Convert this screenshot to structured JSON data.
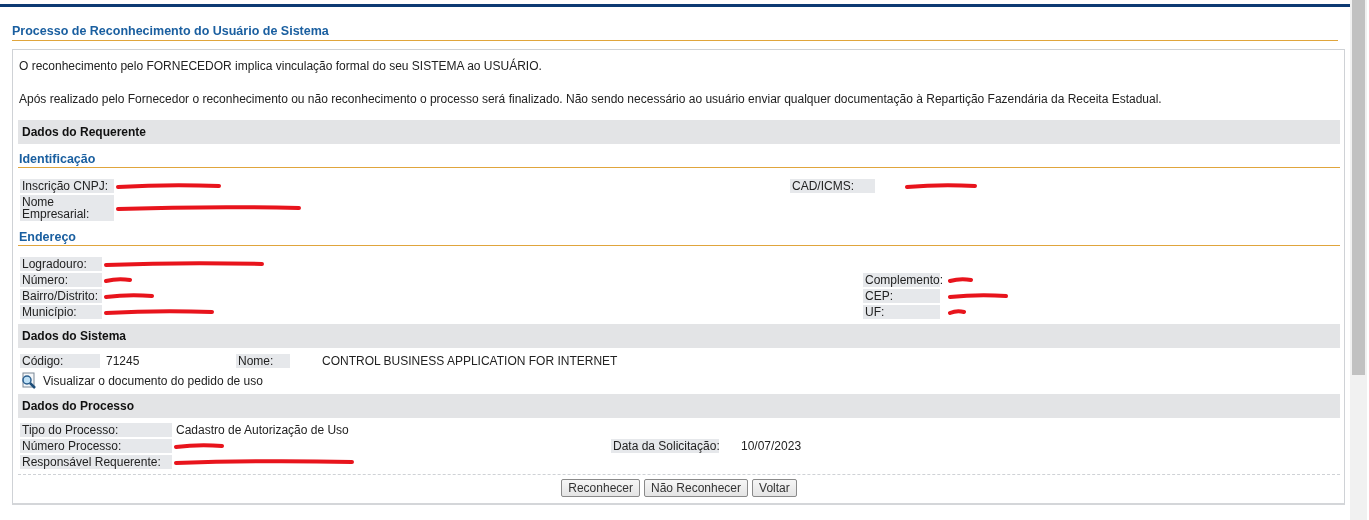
{
  "title": "Processo de Reconhecimento do Usuário de Sistema",
  "intro": [
    "O reconhecimento pelo FORNECEDOR implica vinculação formal do seu SISTEMA ao USUÁRIO.",
    "Após realizado pelo Fornecedor o reconhecimento ou não reconhecimento o processo será finalizado. Não sendo necessário ao usuário enviar qualquer documentação à Repartição Fazendária da Receita Estadual."
  ],
  "sections": [
    {
      "kind": "band",
      "heading": "Dados do Requerente"
    },
    {
      "kind": "subheading",
      "heading": "Identificação",
      "rows": [
        {
          "fields": [
            {
              "label": "Inscrição CNPJ:",
              "redacted": true
            },
            {
              "label": "CAD/ICMS:",
              "redacted": true
            }
          ]
        },
        {
          "fields": [
            {
              "label": "Nome Empresarial:",
              "redacted": true
            }
          ]
        }
      ]
    },
    {
      "kind": "subheading",
      "heading": "Endereço",
      "rows": [
        {
          "fields": [
            {
              "label": "Logradouro:",
              "redacted": true
            }
          ]
        },
        {
          "fields": [
            {
              "label": "Número:",
              "redacted": true
            },
            {
              "label": "Complemento:",
              "redacted": true
            }
          ]
        },
        {
          "fields": [
            {
              "label": "Bairro/Distrito:",
              "redacted": true
            },
            {
              "label": "CEP:",
              "redacted": true
            }
          ]
        },
        {
          "fields": [
            {
              "label": "Município:",
              "redacted": true
            },
            {
              "label": "UF:",
              "redacted": true
            }
          ]
        }
      ]
    },
    {
      "kind": "band",
      "heading": "Dados do Sistema",
      "rows": [
        {
          "fields": [
            {
              "label": "Código:",
              "value": "71245"
            },
            {
              "label": "Nome:",
              "value": "CONTROL BUSINESS APPLICATION FOR INTERNET"
            }
          ]
        }
      ],
      "link": "Visualizar o documento do pedido de uso"
    },
    {
      "kind": "band",
      "heading": "Dados do Processo",
      "rows": [
        {
          "fields": [
            {
              "label": "Tipo do Processo:",
              "value": "Cadastro de Autorização de Uso"
            }
          ]
        },
        {
          "fields": [
            {
              "label": "Número Processo:",
              "redacted": true
            },
            {
              "label": "Data da Solicitação:",
              "value": "10/07/2023"
            }
          ]
        },
        {
          "fields": [
            {
              "label": "Responsável Requerente:",
              "redacted": true
            }
          ]
        }
      ]
    }
  ],
  "buttons": [
    "Reconhecer",
    "Não Reconhecer",
    "Voltar"
  ]
}
